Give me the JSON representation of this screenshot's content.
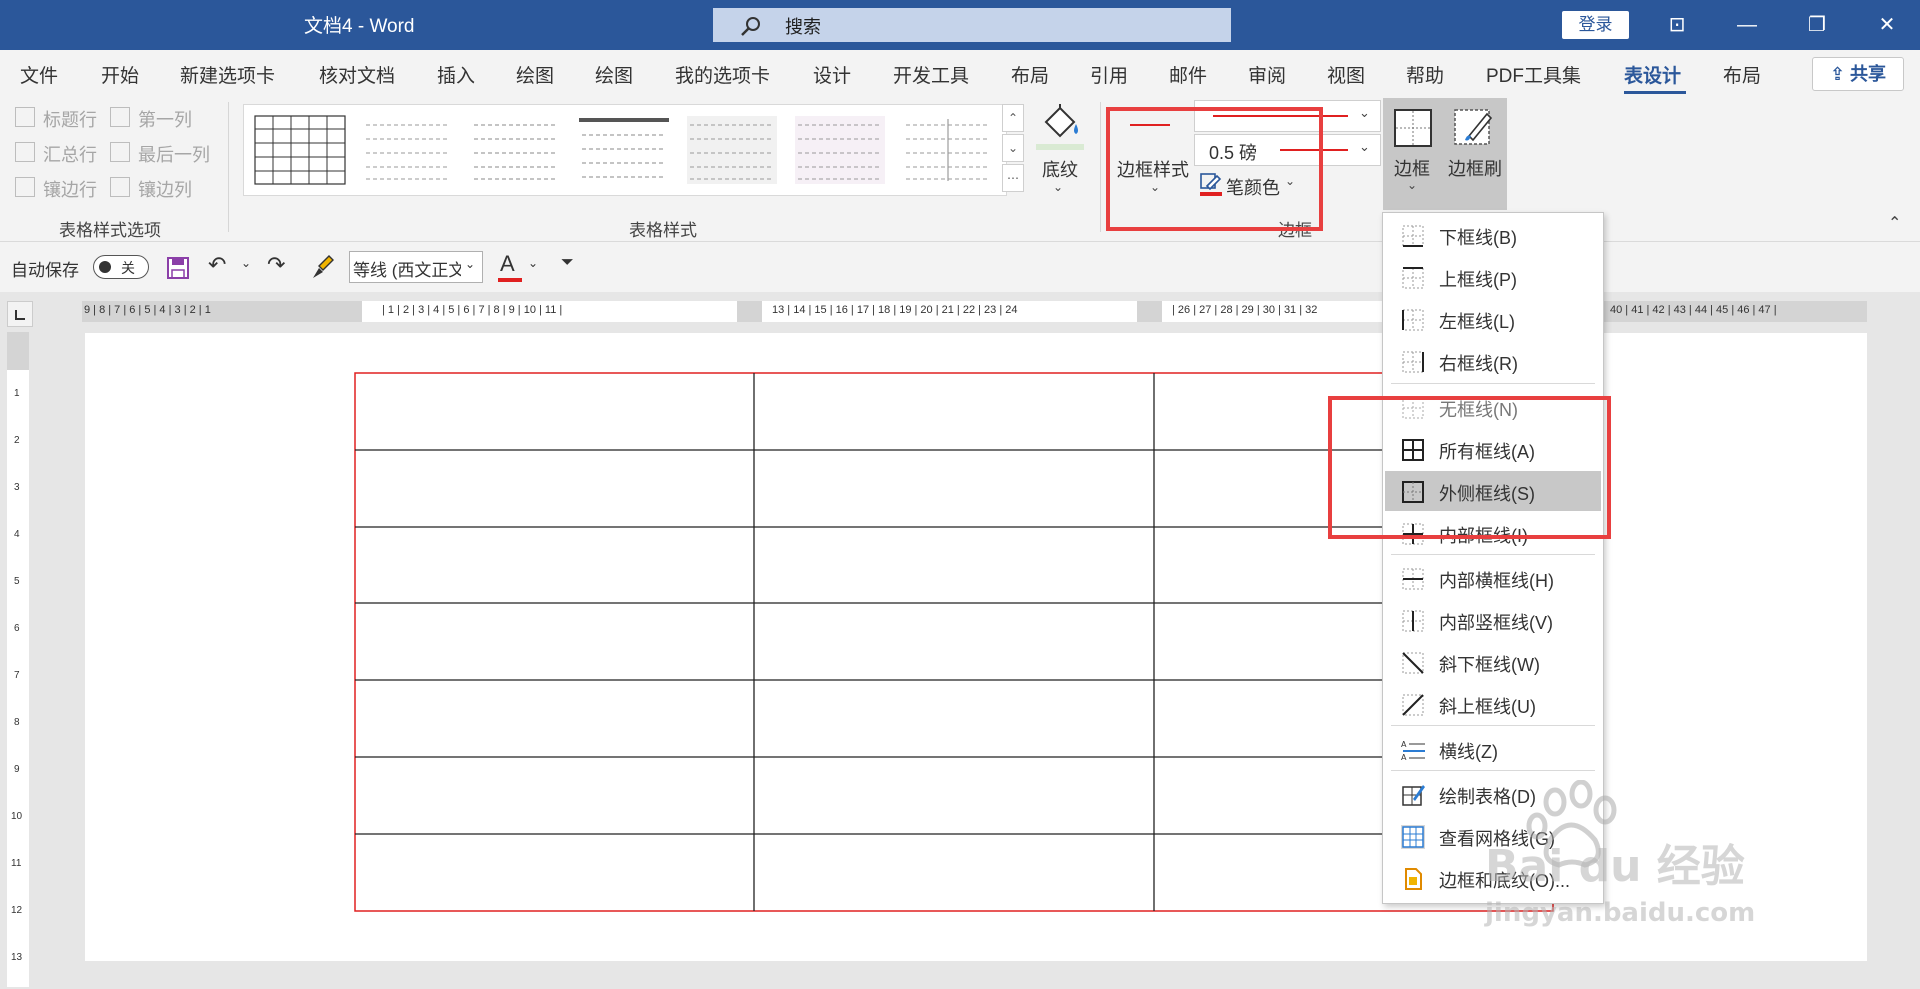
{
  "title_bar": {
    "doc_title": "文档4  -  Word",
    "search_placeholder": "搜索",
    "login_label": "登录",
    "controls": [
      "⊡",
      "—",
      "❐",
      "✕"
    ]
  },
  "tabs": [
    "文件",
    "开始",
    "新建选项卡",
    "核对文档",
    "插入",
    "绘图",
    "绘图",
    "我的选项卡",
    "设计",
    "开发工具",
    "布局",
    "引用",
    "邮件",
    "审阅",
    "视图",
    "帮助",
    "PDF工具集",
    "表设计",
    "布局"
  ],
  "active_tab": "表设计",
  "share_label": "共享",
  "table_style_options": {
    "col1": [
      "标题行",
      "汇总行",
      "镶边行"
    ],
    "col2": [
      "第一列",
      "最后一列",
      "镶边列"
    ],
    "group_label": "表格样式选项"
  },
  "table_styles_group_label": "表格样式",
  "shading_label": "底纹",
  "borders": {
    "border_styles_label": "边框样式",
    "weight_value": "0.5 磅",
    "pen_color_label": "笔颜色",
    "group_label": "边框",
    "borders_btn_label": "边框",
    "border_painter_label": "边框刷",
    "pen_color": "#e02020"
  },
  "qat": {
    "autosave_label": "自动保存",
    "toggle_state": "关",
    "font_name": "等线 (西文正文"
  },
  "ruler_h_left": "9 | 8 | 7 | 6 | 5 | 4 | 3 | 2 | 1",
  "ruler_h_mid1": "| 1 | 2 | 3 | 4 | 5 | 6 | 7 | 8 | 9 | 10 | 11 |",
  "ruler_h_mid2": "13 | 14 | 15 | 16 | 17 | 18 | 19 | 20 | 21 | 22 | 23 | 24",
  "ruler_h_right1": "| 26 | 27 | 28 | 29 | 30 | 31 | 32",
  "ruler_h_right2": "40 | 41 | 42 | 43 | 44 | 45 | 46 | 47 |",
  "ruler_v_numbers": [
    "1",
    "2",
    "3",
    "4",
    "5",
    "6",
    "7",
    "8",
    "9",
    "10",
    "11",
    "12",
    "13"
  ],
  "border_menu": [
    {
      "label": "下框线(B)",
      "icon": "bottom-border-icon"
    },
    {
      "label": "上框线(P)",
      "icon": "top-border-icon"
    },
    {
      "label": "左框线(L)",
      "icon": "left-border-icon"
    },
    {
      "label": "右框线(R)",
      "icon": "right-border-icon"
    },
    {
      "label": "无框线(N)",
      "icon": "no-border-icon"
    },
    {
      "label": "所有框线(A)",
      "icon": "all-borders-icon"
    },
    {
      "label": "外侧框线(S)",
      "icon": "outside-borders-icon"
    },
    {
      "label": "内部框线(I)",
      "icon": "inside-borders-icon"
    },
    {
      "label": "内部横框线(H)",
      "icon": "inside-horizontal-border-icon"
    },
    {
      "label": "内部竖框线(V)",
      "icon": "inside-vertical-border-icon"
    },
    {
      "label": "斜下框线(W)",
      "icon": "diagonal-down-border-icon"
    },
    {
      "label": "斜上框线(U)",
      "icon": "diagonal-up-border-icon"
    },
    {
      "label": "横线(Z)",
      "icon": "horizontal-line-icon"
    },
    {
      "label": "绘制表格(D)",
      "icon": "draw-table-icon"
    },
    {
      "label": "查看网格线(G)",
      "icon": "view-gridlines-icon"
    },
    {
      "label": "边框和底纹(O)...",
      "icon": "borders-shading-icon"
    }
  ],
  "watermark": {
    "brand": "Bai  du 经验",
    "url": "jingyan.baidu.com"
  }
}
